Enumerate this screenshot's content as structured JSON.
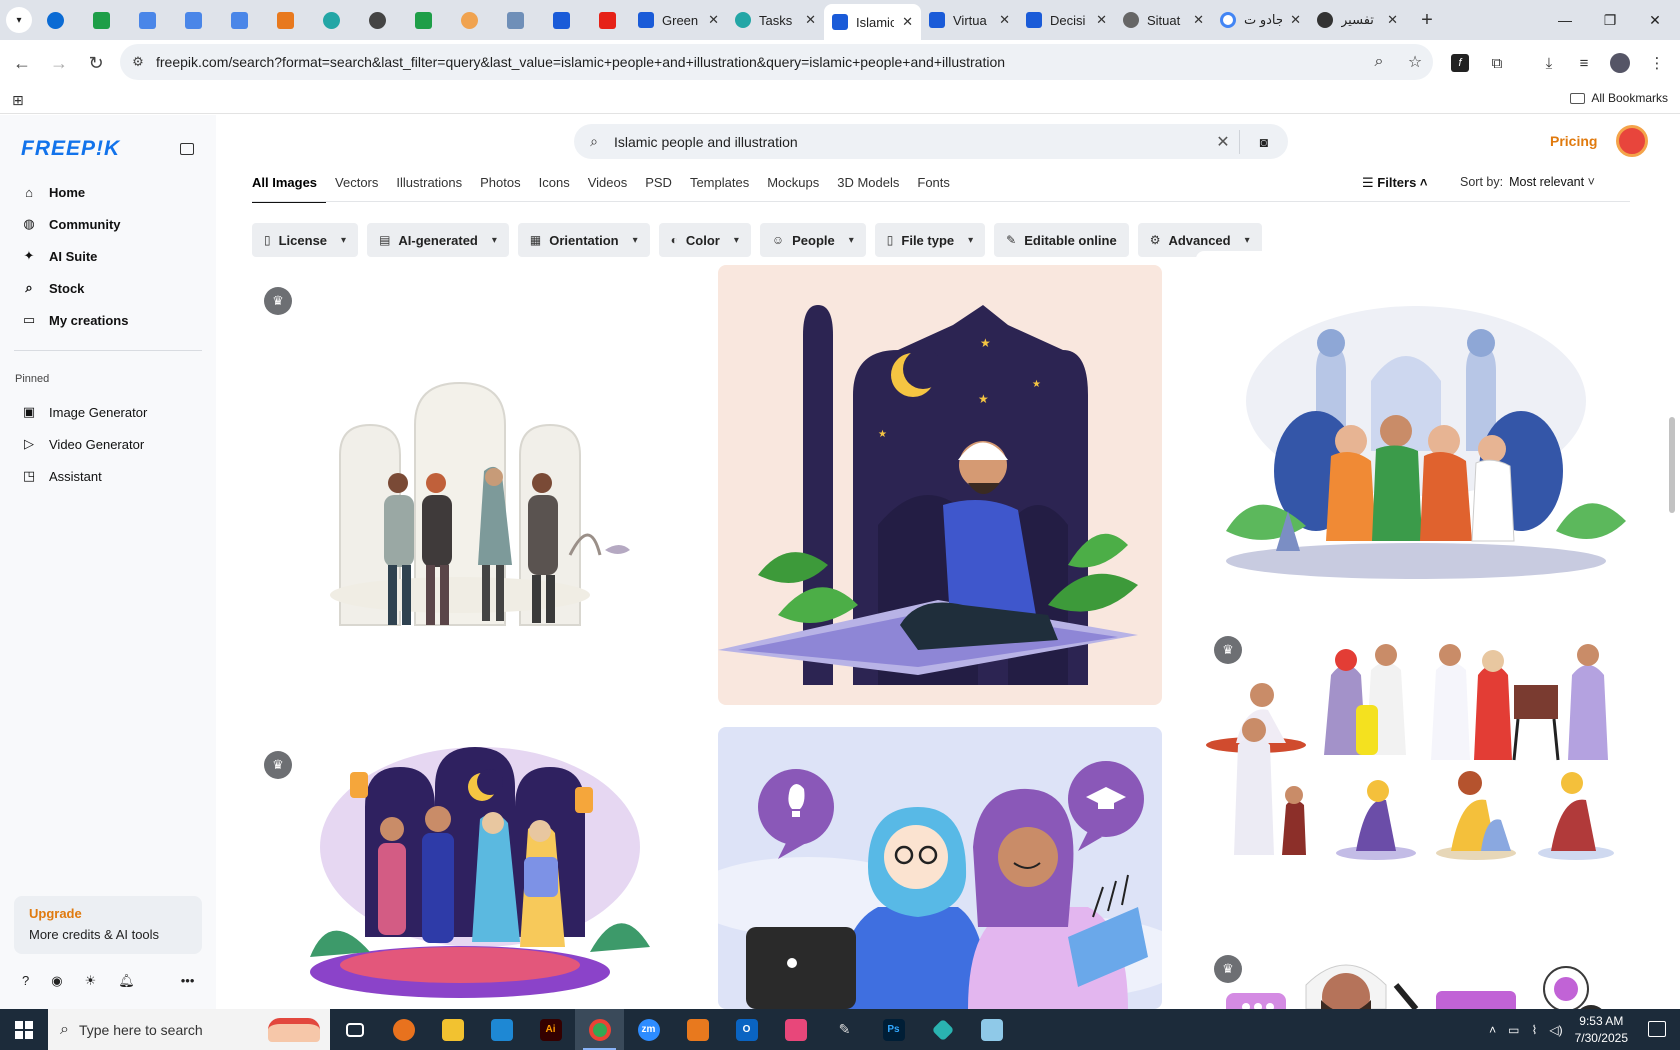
{
  "browser": {
    "tabs": [
      {
        "title": "Green",
        "icon_color": "#1a73e8"
      },
      {
        "title": "Tasks",
        "icon_color": "#23a6a6"
      },
      {
        "title": "Islamic",
        "icon_color": "#1a5bd8",
        "active": true
      },
      {
        "title": "Virtua",
        "icon_color": "#1a5bd8"
      },
      {
        "title": "Decisi",
        "icon_color": "#1a5bd8"
      },
      {
        "title": "Situat",
        "icon_color": "#555555"
      },
      {
        "title": "جادو ت",
        "icon_color": "#4285f4"
      },
      {
        "title": "تفسير",
        "icon_color": "#333333"
      }
    ],
    "address": "freepik.com/search?format=search&last_filter=query&last_value=islamic+people+and+illustration&query=islamic+people+and+illustration",
    "all_bookmarks": "All Bookmarks"
  },
  "sidebar": {
    "logo": "FREEP!K",
    "nav": [
      {
        "label": "Home",
        "icon": "home-icon"
      },
      {
        "label": "Community",
        "icon": "globe-icon"
      },
      {
        "label": "AI Suite",
        "icon": "sparkle-icon"
      },
      {
        "label": "Stock",
        "icon": "search-icon"
      },
      {
        "label": "My creations",
        "icon": "folder-icon"
      }
    ],
    "pinned_heading": "Pinned",
    "pinned": [
      {
        "label": "Image Generator",
        "icon": "image-icon"
      },
      {
        "label": "Video Generator",
        "icon": "video-icon"
      },
      {
        "label": "Assistant",
        "icon": "chat-icon"
      }
    ],
    "upgrade": {
      "title": "Upgrade",
      "subtitle": "More credits & AI tools"
    }
  },
  "search": {
    "value": "Islamic people and illustration"
  },
  "header": {
    "pricing": "Pricing"
  },
  "categories": [
    "All Images",
    "Vectors",
    "Illustrations",
    "Photos",
    "Icons",
    "Videos",
    "PSD",
    "Templates",
    "Mockups",
    "3D Models",
    "Fonts"
  ],
  "filters_label": "Filters",
  "sort": {
    "label": "Sort by:",
    "value": "Most relevant"
  },
  "chips": [
    {
      "label": "License",
      "icon": "license-icon"
    },
    {
      "label": "AI-generated",
      "icon": "ai-icon"
    },
    {
      "label": "Orientation",
      "icon": "orientation-icon"
    },
    {
      "label": "Color",
      "icon": "palette-icon"
    },
    {
      "label": "People",
      "icon": "people-icon"
    },
    {
      "label": "File type",
      "icon": "file-icon"
    },
    {
      "label": "Editable online",
      "icon": "pen-icon"
    },
    {
      "label": "Advanced",
      "icon": "gear-icon"
    }
  ],
  "taskbar": {
    "search_placeholder": "Type here to search",
    "time": "9:53 AM",
    "date": "7/30/2025"
  }
}
